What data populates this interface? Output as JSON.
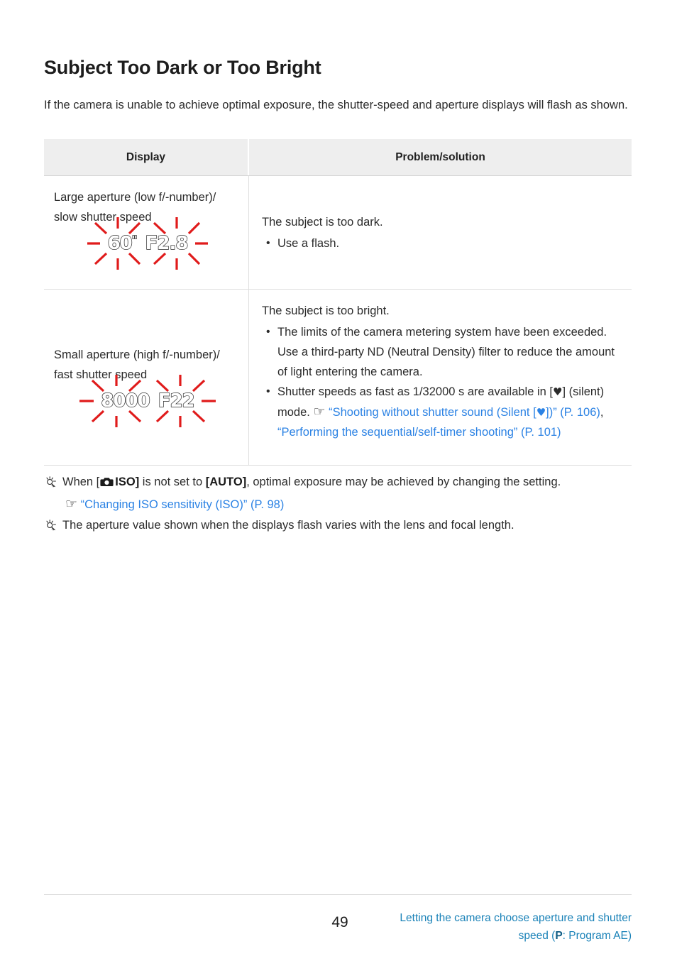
{
  "document": {
    "title": "Subject Too Dark or Too Bright",
    "intro": "If the camera is unable to achieve optimal exposure, the shutter-speed and aperture displays will flash as shown."
  },
  "table": {
    "headers": {
      "display": "Display",
      "problem": "Problem/solution"
    },
    "rows": [
      {
        "display_label_line1": "Large aperture (low f/-number)/",
        "display_label_line2": "slow shutter speed",
        "lcd_shutter": "60",
        "lcd_shutter_unit": "\"",
        "lcd_aperture": "F2.8",
        "solution_lead": "The subject is too dark.",
        "bullets": [
          {
            "text": "Use a flash."
          }
        ]
      },
      {
        "display_label_line1": "Small aperture (high f/-number)/",
        "display_label_line2": "fast shutter speed",
        "lcd_shutter": "8000",
        "lcd_shutter_unit": "",
        "lcd_aperture": "F22",
        "solution_lead": "The subject is too bright.",
        "bullets": [
          {
            "text": "The limits of the camera metering system have been exceeded. Use a third-party ND (Neutral Density) filter to reduce the amount of light entering the camera."
          },
          {
            "text_before": "Shutter speeds as fast as 1/32000 s are available in [",
            "heart": "♥",
            "text_after": "] (silent) mode.",
            "hand_icon": "☞",
            "link1_a": "“Shooting without shutter sound (Silent [",
            "link1_heart": "♥",
            "link1_b": "])” (P. 106)",
            "separator": ", ",
            "link2": "“Performing the sequential/self-timer shooting” (P. 101)"
          }
        ]
      }
    ]
  },
  "notes": [
    {
      "lead": "When [",
      "camera_icon": "camera-icon",
      "iso_label": "ISO]",
      "middle": " is not set to ",
      "auto_label": "[AUTO]",
      "tail": ", optimal exposure may be achieved by changing the setting.",
      "sub_hand_icon": "☞",
      "sub_link": "“Changing ISO sensitivity (ISO)” (P. 98)"
    },
    {
      "lead": "The aperture value shown when the displays flash varies with the lens and focal length."
    }
  ],
  "footer": {
    "page_number": "49",
    "crumb_line1": "Letting the camera choose aperture and shutter",
    "crumb_line2_before": "speed (",
    "crumb_mode": "P",
    "crumb_line2_after": ": Program AE)"
  },
  "colors": {
    "link_blue": "#2b82e4",
    "footer_teal": "#1a82b8",
    "flash_red": "#e01b1b",
    "header_gray": "#eeeeee"
  },
  "icons": {
    "hand_pointing": "☞",
    "heart": "♥"
  }
}
